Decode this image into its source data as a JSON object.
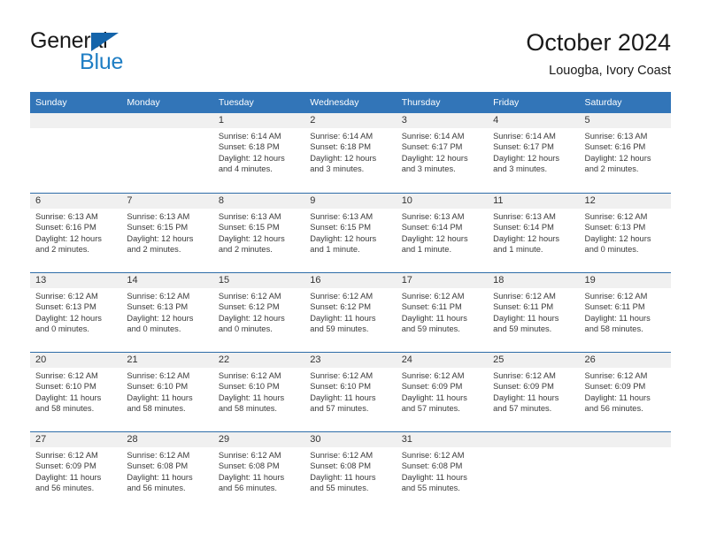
{
  "logo": {
    "word_top": "General",
    "word_bottom": "Blue",
    "triangle_color": "#1464aa",
    "blue_color": "#1f7ec4"
  },
  "header": {
    "title": "October 2024",
    "subtitle": "Louogba, Ivory Coast"
  },
  "theme": {
    "header_bg": "#3275b8",
    "row_rule": "#2e6da8",
    "daynum_bg": "#f0f0f0",
    "text": "#3a3a3a"
  },
  "weekday_headers": [
    "Sunday",
    "Monday",
    "Tuesday",
    "Wednesday",
    "Thursday",
    "Friday",
    "Saturday"
  ],
  "labels": {
    "sunrise_prefix": "Sunrise: ",
    "sunset_prefix": "Sunset: ",
    "daylight_prefix": "Daylight: "
  },
  "weeks": [
    [
      {
        "day": "",
        "empty": true
      },
      {
        "day": "",
        "empty": true
      },
      {
        "day": "1",
        "sunrise": "Sunrise: 6:14 AM",
        "sunset": "Sunset: 6:18 PM",
        "daylight1": "Daylight: 12 hours",
        "daylight2": "and 4 minutes."
      },
      {
        "day": "2",
        "sunrise": "Sunrise: 6:14 AM",
        "sunset": "Sunset: 6:18 PM",
        "daylight1": "Daylight: 12 hours",
        "daylight2": "and 3 minutes."
      },
      {
        "day": "3",
        "sunrise": "Sunrise: 6:14 AM",
        "sunset": "Sunset: 6:17 PM",
        "daylight1": "Daylight: 12 hours",
        "daylight2": "and 3 minutes."
      },
      {
        "day": "4",
        "sunrise": "Sunrise: 6:14 AM",
        "sunset": "Sunset: 6:17 PM",
        "daylight1": "Daylight: 12 hours",
        "daylight2": "and 3 minutes."
      },
      {
        "day": "5",
        "sunrise": "Sunrise: 6:13 AM",
        "sunset": "Sunset: 6:16 PM",
        "daylight1": "Daylight: 12 hours",
        "daylight2": "and 2 minutes."
      }
    ],
    [
      {
        "day": "6",
        "sunrise": "Sunrise: 6:13 AM",
        "sunset": "Sunset: 6:16 PM",
        "daylight1": "Daylight: 12 hours",
        "daylight2": "and 2 minutes."
      },
      {
        "day": "7",
        "sunrise": "Sunrise: 6:13 AM",
        "sunset": "Sunset: 6:15 PM",
        "daylight1": "Daylight: 12 hours",
        "daylight2": "and 2 minutes."
      },
      {
        "day": "8",
        "sunrise": "Sunrise: 6:13 AM",
        "sunset": "Sunset: 6:15 PM",
        "daylight1": "Daylight: 12 hours",
        "daylight2": "and 2 minutes."
      },
      {
        "day": "9",
        "sunrise": "Sunrise: 6:13 AM",
        "sunset": "Sunset: 6:15 PM",
        "daylight1": "Daylight: 12 hours",
        "daylight2": "and 1 minute."
      },
      {
        "day": "10",
        "sunrise": "Sunrise: 6:13 AM",
        "sunset": "Sunset: 6:14 PM",
        "daylight1": "Daylight: 12 hours",
        "daylight2": "and 1 minute."
      },
      {
        "day": "11",
        "sunrise": "Sunrise: 6:13 AM",
        "sunset": "Sunset: 6:14 PM",
        "daylight1": "Daylight: 12 hours",
        "daylight2": "and 1 minute."
      },
      {
        "day": "12",
        "sunrise": "Sunrise: 6:12 AM",
        "sunset": "Sunset: 6:13 PM",
        "daylight1": "Daylight: 12 hours",
        "daylight2": "and 0 minutes."
      }
    ],
    [
      {
        "day": "13",
        "sunrise": "Sunrise: 6:12 AM",
        "sunset": "Sunset: 6:13 PM",
        "daylight1": "Daylight: 12 hours",
        "daylight2": "and 0 minutes."
      },
      {
        "day": "14",
        "sunrise": "Sunrise: 6:12 AM",
        "sunset": "Sunset: 6:13 PM",
        "daylight1": "Daylight: 12 hours",
        "daylight2": "and 0 minutes."
      },
      {
        "day": "15",
        "sunrise": "Sunrise: 6:12 AM",
        "sunset": "Sunset: 6:12 PM",
        "daylight1": "Daylight: 12 hours",
        "daylight2": "and 0 minutes."
      },
      {
        "day": "16",
        "sunrise": "Sunrise: 6:12 AM",
        "sunset": "Sunset: 6:12 PM",
        "daylight1": "Daylight: 11 hours",
        "daylight2": "and 59 minutes."
      },
      {
        "day": "17",
        "sunrise": "Sunrise: 6:12 AM",
        "sunset": "Sunset: 6:11 PM",
        "daylight1": "Daylight: 11 hours",
        "daylight2": "and 59 minutes."
      },
      {
        "day": "18",
        "sunrise": "Sunrise: 6:12 AM",
        "sunset": "Sunset: 6:11 PM",
        "daylight1": "Daylight: 11 hours",
        "daylight2": "and 59 minutes."
      },
      {
        "day": "19",
        "sunrise": "Sunrise: 6:12 AM",
        "sunset": "Sunset: 6:11 PM",
        "daylight1": "Daylight: 11 hours",
        "daylight2": "and 58 minutes."
      }
    ],
    [
      {
        "day": "20",
        "sunrise": "Sunrise: 6:12 AM",
        "sunset": "Sunset: 6:10 PM",
        "daylight1": "Daylight: 11 hours",
        "daylight2": "and 58 minutes."
      },
      {
        "day": "21",
        "sunrise": "Sunrise: 6:12 AM",
        "sunset": "Sunset: 6:10 PM",
        "daylight1": "Daylight: 11 hours",
        "daylight2": "and 58 minutes."
      },
      {
        "day": "22",
        "sunrise": "Sunrise: 6:12 AM",
        "sunset": "Sunset: 6:10 PM",
        "daylight1": "Daylight: 11 hours",
        "daylight2": "and 58 minutes."
      },
      {
        "day": "23",
        "sunrise": "Sunrise: 6:12 AM",
        "sunset": "Sunset: 6:10 PM",
        "daylight1": "Daylight: 11 hours",
        "daylight2": "and 57 minutes."
      },
      {
        "day": "24",
        "sunrise": "Sunrise: 6:12 AM",
        "sunset": "Sunset: 6:09 PM",
        "daylight1": "Daylight: 11 hours",
        "daylight2": "and 57 minutes."
      },
      {
        "day": "25",
        "sunrise": "Sunrise: 6:12 AM",
        "sunset": "Sunset: 6:09 PM",
        "daylight1": "Daylight: 11 hours",
        "daylight2": "and 57 minutes."
      },
      {
        "day": "26",
        "sunrise": "Sunrise: 6:12 AM",
        "sunset": "Sunset: 6:09 PM",
        "daylight1": "Daylight: 11 hours",
        "daylight2": "and 56 minutes."
      }
    ],
    [
      {
        "day": "27",
        "sunrise": "Sunrise: 6:12 AM",
        "sunset": "Sunset: 6:09 PM",
        "daylight1": "Daylight: 11 hours",
        "daylight2": "and 56 minutes."
      },
      {
        "day": "28",
        "sunrise": "Sunrise: 6:12 AM",
        "sunset": "Sunset: 6:08 PM",
        "daylight1": "Daylight: 11 hours",
        "daylight2": "and 56 minutes."
      },
      {
        "day": "29",
        "sunrise": "Sunrise: 6:12 AM",
        "sunset": "Sunset: 6:08 PM",
        "daylight1": "Daylight: 11 hours",
        "daylight2": "and 56 minutes."
      },
      {
        "day": "30",
        "sunrise": "Sunrise: 6:12 AM",
        "sunset": "Sunset: 6:08 PM",
        "daylight1": "Daylight: 11 hours",
        "daylight2": "and 55 minutes."
      },
      {
        "day": "31",
        "sunrise": "Sunrise: 6:12 AM",
        "sunset": "Sunset: 6:08 PM",
        "daylight1": "Daylight: 11 hours",
        "daylight2": "and 55 minutes."
      },
      {
        "day": "",
        "empty": true
      },
      {
        "day": "",
        "empty": true
      }
    ]
  ]
}
